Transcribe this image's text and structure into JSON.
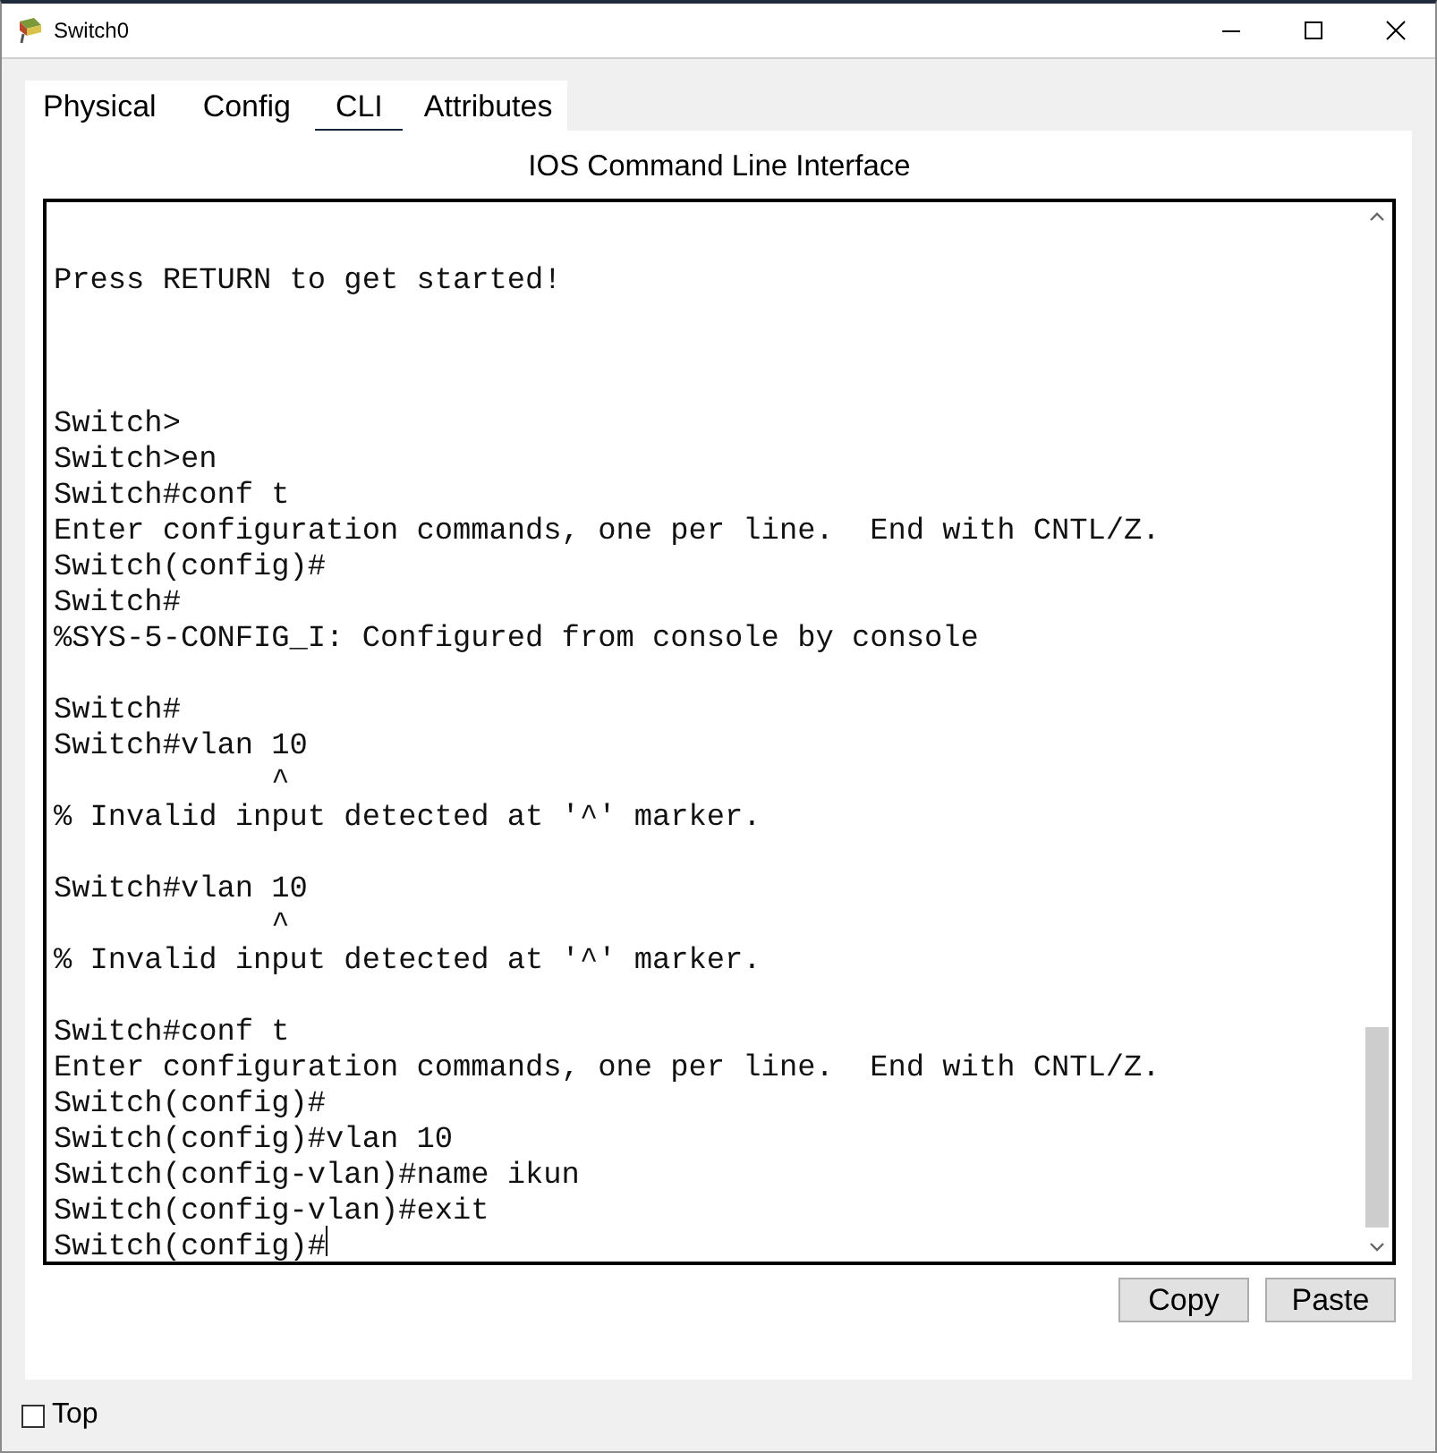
{
  "window": {
    "title": "Switch0"
  },
  "tabs": [
    {
      "label": "Physical",
      "selected": false
    },
    {
      "label": "Config",
      "selected": false
    },
    {
      "label": "CLI",
      "selected": true
    },
    {
      "label": "Attributes",
      "selected": false
    }
  ],
  "cli": {
    "heading": "IOS Command Line Interface",
    "output": "Press RETURN to get started!\n\n\n\nSwitch>\nSwitch>en\nSwitch#conf t\nEnter configuration commands, one per line.  End with CNTL/Z.\nSwitch(config)#\nSwitch#\n%SYS-5-CONFIG_I: Configured from console by console\n\nSwitch#\nSwitch#vlan 10\n            ^\n% Invalid input detected at '^' marker.\n\nSwitch#vlan 10\n            ^\n% Invalid input detected at '^' marker.\n\nSwitch#conf t\nEnter configuration commands, one per line.  End with CNTL/Z.\nSwitch(config)#\nSwitch(config)#vlan 10\nSwitch(config-vlan)#name ikun\nSwitch(config-vlan)#exit\nSwitch(config)#",
    "buttons": [
      "Copy",
      "Paste"
    ]
  },
  "top_option": {
    "label": "Top",
    "checked": false
  }
}
